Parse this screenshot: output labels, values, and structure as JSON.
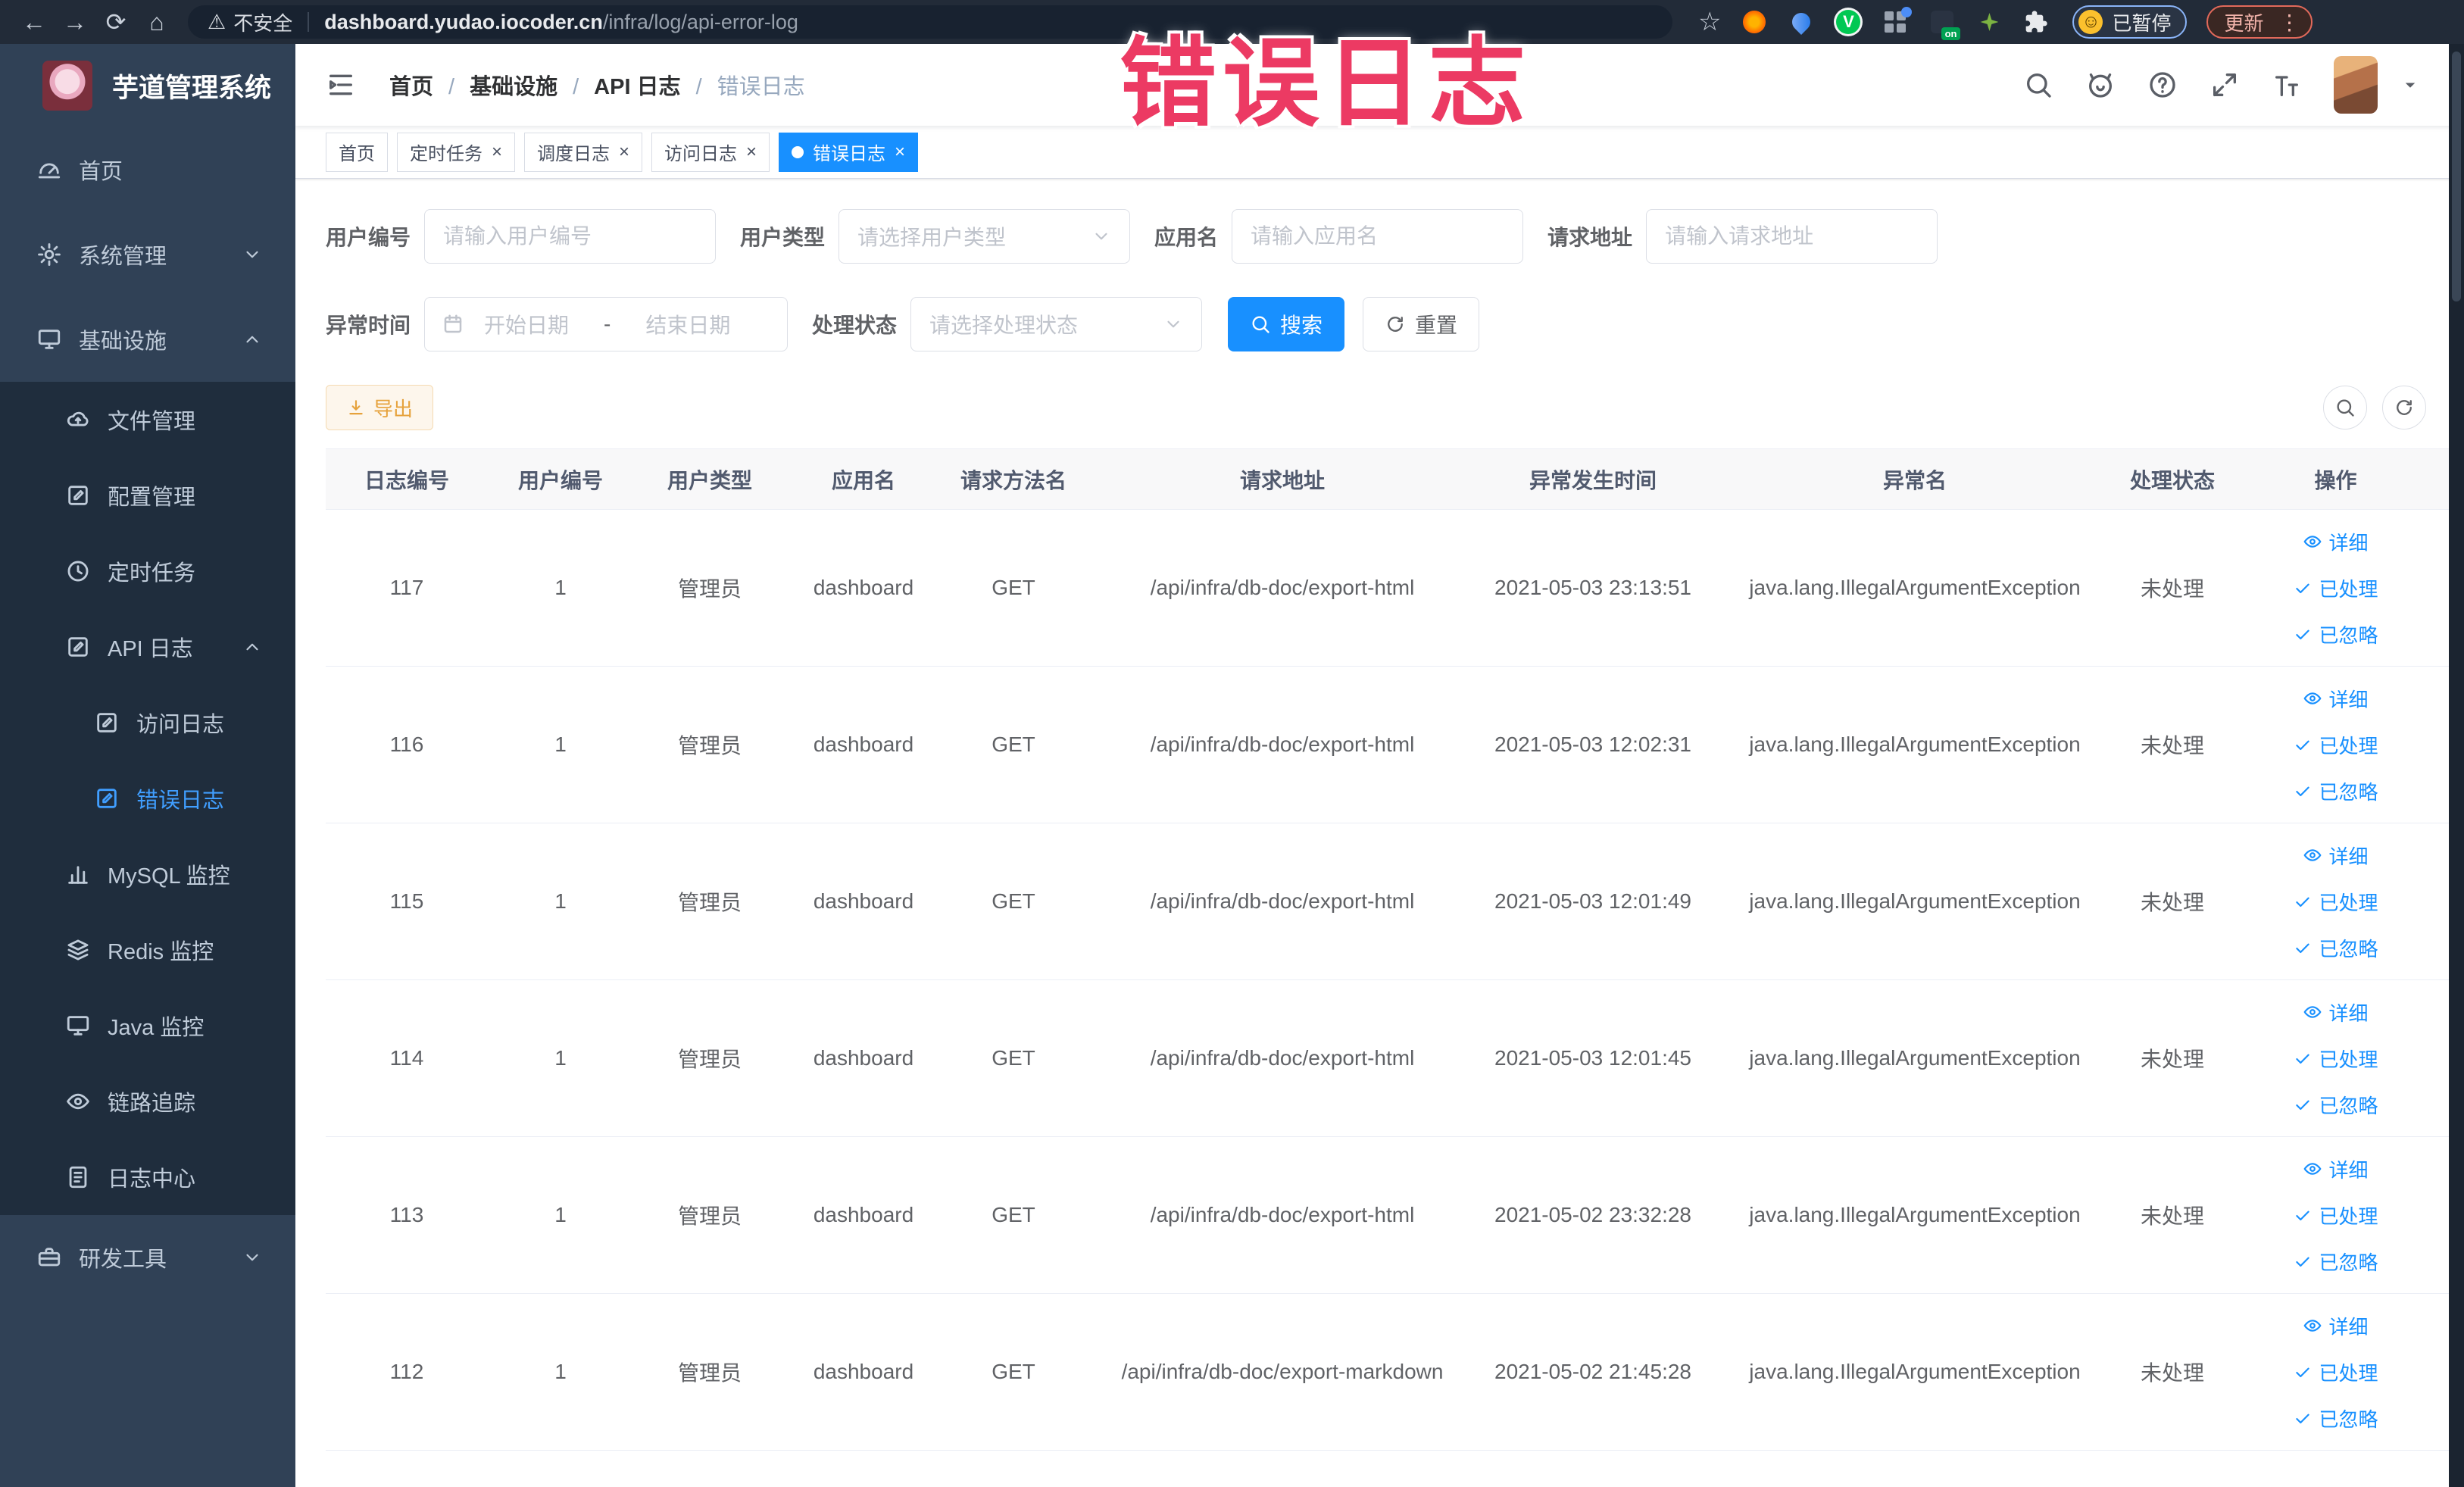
{
  "overlay": {
    "title": "错误日志"
  },
  "browser": {
    "security_chip": "不安全",
    "url_domain": "dashboard.yudao.iocoder.cn",
    "url_path": "/infra/log/api-error-log",
    "ext_on_badge": "on",
    "paused_badge": "已暂停",
    "update_badge": "更新"
  },
  "sidebar": {
    "logo_title": "芋道管理系统",
    "items": [
      {
        "label": "首页"
      },
      {
        "label": "系统管理"
      },
      {
        "label": "基础设施"
      },
      {
        "label": "文件管理"
      },
      {
        "label": "配置管理"
      },
      {
        "label": "定时任务"
      },
      {
        "label": "API 日志"
      },
      {
        "label": "访问日志"
      },
      {
        "label": "错误日志"
      },
      {
        "label": "MySQL 监控"
      },
      {
        "label": "Redis 监控"
      },
      {
        "label": "Java 监控"
      },
      {
        "label": "链路追踪"
      },
      {
        "label": "日志中心"
      },
      {
        "label": "研发工具"
      }
    ]
  },
  "breadcrumb": {
    "items": [
      "首页",
      "基础设施",
      "API 日志",
      "错误日志"
    ]
  },
  "tabs": [
    {
      "label": "首页"
    },
    {
      "label": "定时任务"
    },
    {
      "label": "调度日志"
    },
    {
      "label": "访问日志"
    },
    {
      "label": "错误日志"
    }
  ],
  "filters": {
    "user_id_label": "用户编号",
    "user_id_placeholder": "请输入用户编号",
    "user_type_label": "用户类型",
    "user_type_placeholder": "请选择用户类型",
    "app_name_label": "应用名",
    "app_name_placeholder": "请输入应用名",
    "request_url_label": "请求地址",
    "request_url_placeholder": "请输入请求地址",
    "exception_time_label": "异常时间",
    "date_start_placeholder": "开始日期",
    "date_separator": "-",
    "date_end_placeholder": "结束日期",
    "process_status_label": "处理状态",
    "process_status_placeholder": "请选择处理状态",
    "search_button": "搜索",
    "reset_button": "重置"
  },
  "toolbar": {
    "export_button": "导出"
  },
  "table": {
    "columns": [
      "日志编号",
      "用户编号",
      "用户类型",
      "应用名",
      "请求方法名",
      "请求地址",
      "异常发生时间",
      "异常名",
      "处理状态",
      "操作"
    ],
    "op_labels": {
      "detail": "详细",
      "processed": "已处理",
      "ignored": "已忽略"
    },
    "rows": [
      {
        "id": "117",
        "user_id": "1",
        "user_type": "管理员",
        "app": "dashboard",
        "method": "GET",
        "url": "/api/infra/db-doc/export-html",
        "time": "2021-05-03 23:13:51",
        "exception": "java.lang.IllegalArgumentException",
        "status": "未处理"
      },
      {
        "id": "116",
        "user_id": "1",
        "user_type": "管理员",
        "app": "dashboard",
        "method": "GET",
        "url": "/api/infra/db-doc/export-html",
        "time": "2021-05-03 12:02:31",
        "exception": "java.lang.IllegalArgumentException",
        "status": "未处理"
      },
      {
        "id": "115",
        "user_id": "1",
        "user_type": "管理员",
        "app": "dashboard",
        "method": "GET",
        "url": "/api/infra/db-doc/export-html",
        "time": "2021-05-03 12:01:49",
        "exception": "java.lang.IllegalArgumentException",
        "status": "未处理"
      },
      {
        "id": "114",
        "user_id": "1",
        "user_type": "管理员",
        "app": "dashboard",
        "method": "GET",
        "url": "/api/infra/db-doc/export-html",
        "time": "2021-05-03 12:01:45",
        "exception": "java.lang.IllegalArgumentException",
        "status": "未处理"
      },
      {
        "id": "113",
        "user_id": "1",
        "user_type": "管理员",
        "app": "dashboard",
        "method": "GET",
        "url": "/api/infra/db-doc/export-html",
        "time": "2021-05-02 23:32:28",
        "exception": "java.lang.IllegalArgumentException",
        "status": "未处理"
      },
      {
        "id": "112",
        "user_id": "1",
        "user_type": "管理员",
        "app": "dashboard",
        "method": "GET",
        "url": "/api/infra/db-doc/export-markdown",
        "time": "2021-05-02 21:45:28",
        "exception": "java.lang.IllegalArgumentException",
        "status": "未处理"
      }
    ]
  }
}
